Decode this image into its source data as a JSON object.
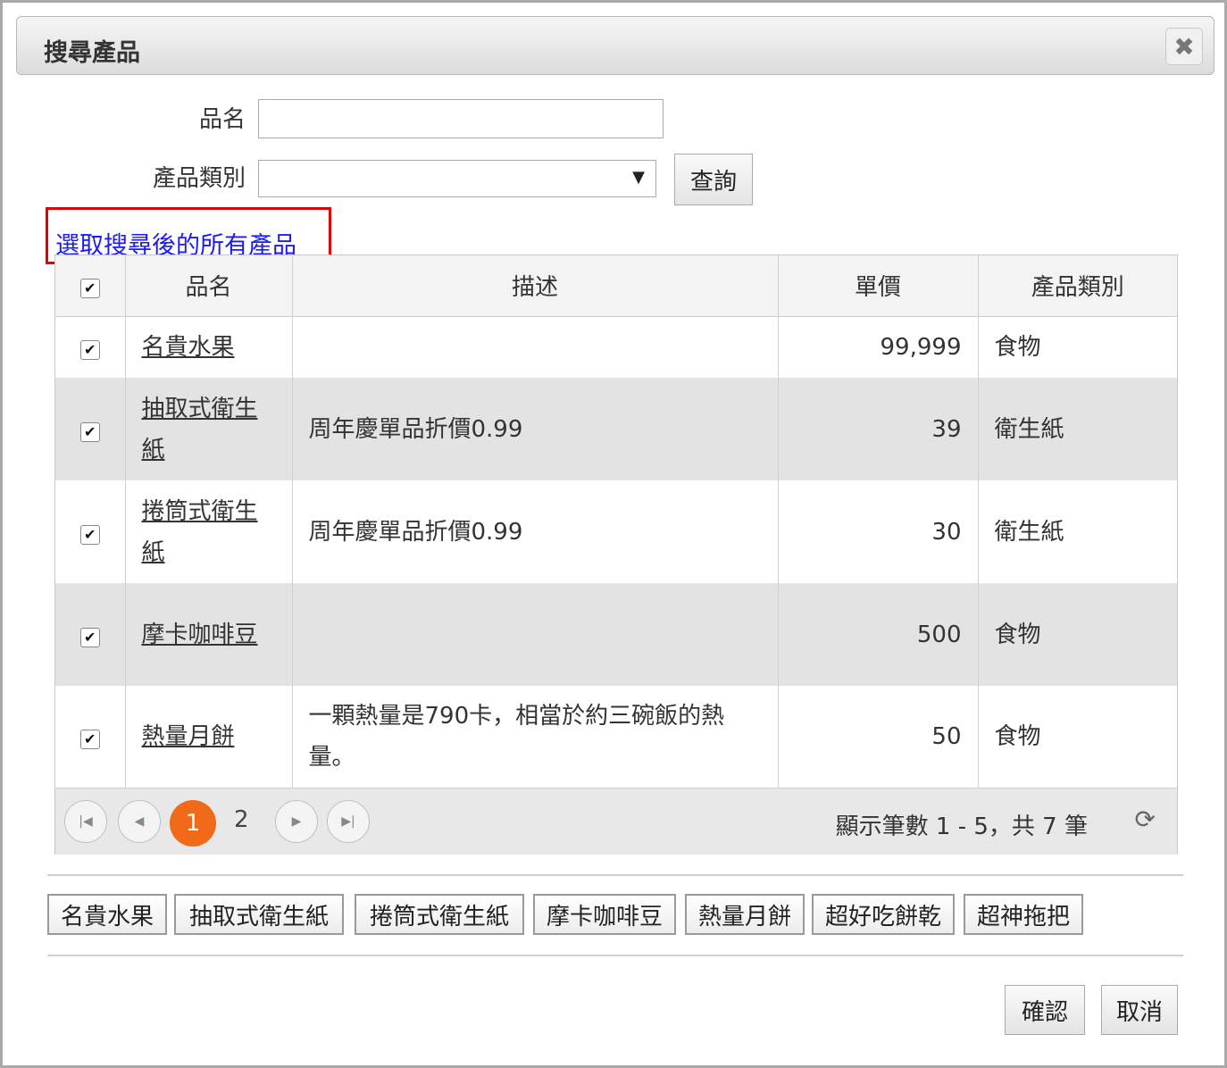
{
  "dialog": {
    "title": "搜尋產品",
    "close_icon": "✖"
  },
  "form": {
    "name_label": "品名",
    "name_value": "",
    "category_label": "產品類別",
    "category_value": "",
    "select_arrow": "▼",
    "search_button": "查詢"
  },
  "select_all_link": "選取搜尋後的所有產品",
  "table": {
    "headers": [
      "品名",
      "描述",
      "單價",
      "產品類別"
    ],
    "rows": [
      {
        "name": "名貴水果",
        "description": "",
        "price": "99,999",
        "category": "食物",
        "checked": true
      },
      {
        "name": "抽取式衛生紙",
        "description": "周年慶單品折價0.99",
        "price": "39",
        "category": "衛生紙",
        "checked": true
      },
      {
        "name": "捲筒式衛生紙",
        "description": "周年慶單品折價0.99",
        "price": "30",
        "category": "衛生紙",
        "checked": true
      },
      {
        "name": "摩卡咖啡豆",
        "description": "",
        "price": "500",
        "category": "食物",
        "checked": true
      },
      {
        "name": "熱量月餅",
        "description": "一顆熱量是790卡，相當於約三碗飯的熱量。",
        "price": "50",
        "category": "食物",
        "checked": true
      }
    ]
  },
  "pager": {
    "current_page": "1",
    "next_page": "2",
    "info": "顯示筆數 1 - 5，共 7 筆",
    "refresh_icon": "⟳"
  },
  "selected_items": [
    "名貴水果",
    "抽取式衛生紙",
    "捲筒式衛生紙",
    "摩卡咖啡豆",
    "熱量月餅",
    "超好吃餅乾",
    "超神拖把"
  ],
  "buttons": {
    "confirm": "確認",
    "cancel": "取消"
  },
  "colors": {
    "highlight_border": "#e00000",
    "link": "#1a1aff",
    "current_page": "#f06a1a"
  }
}
